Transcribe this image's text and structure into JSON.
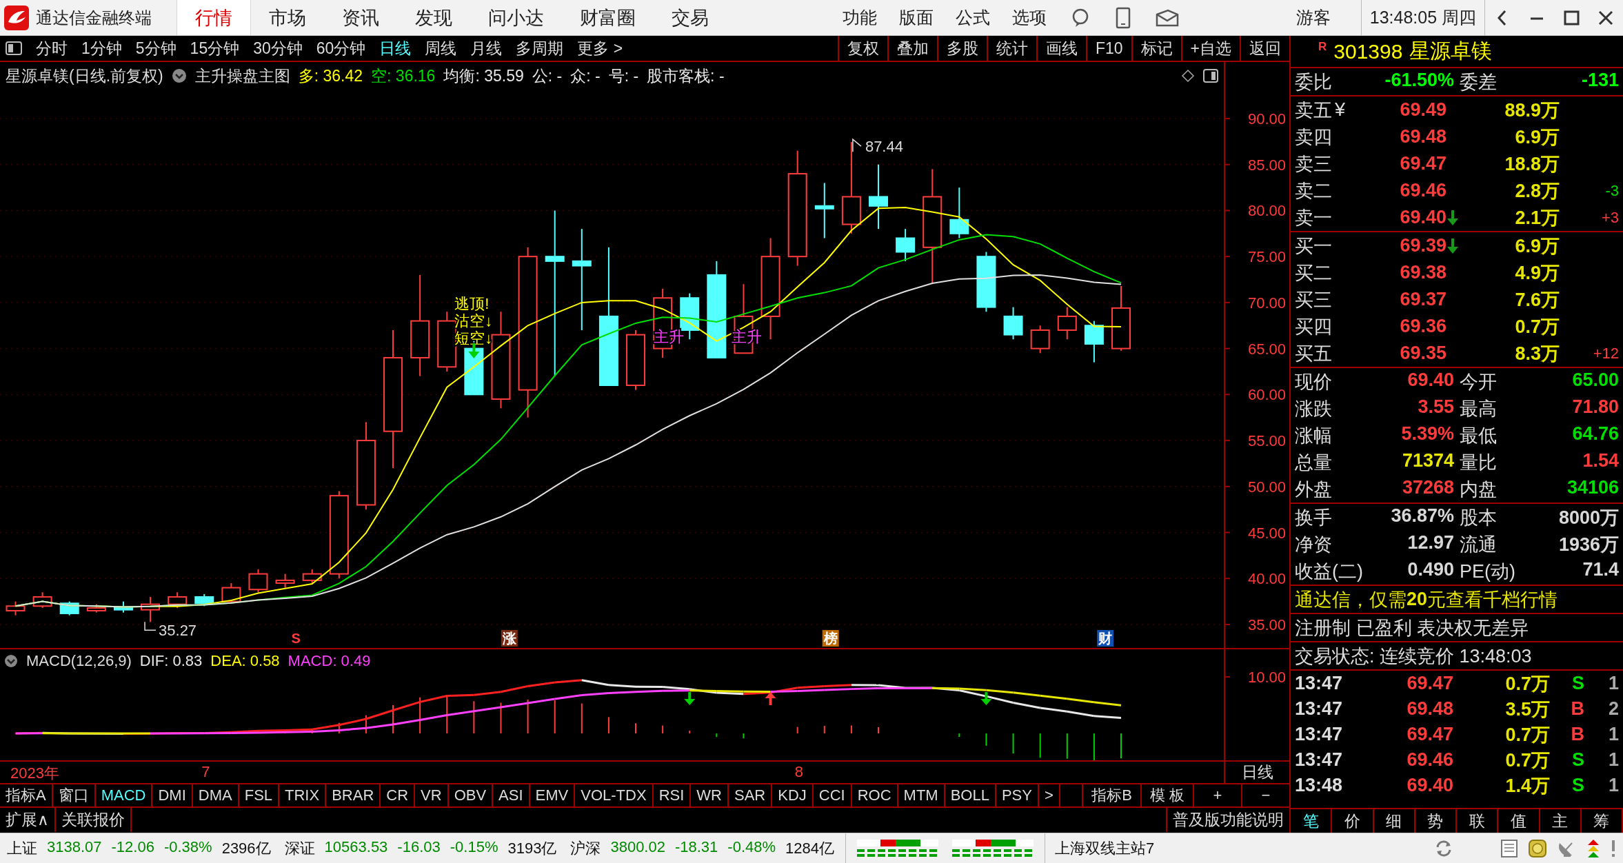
{
  "app": {
    "title": "通达信金融终端"
  },
  "menu": [
    {
      "label": "行情",
      "selected": true
    },
    {
      "label": "市场",
      "selected": false
    },
    {
      "label": "资讯",
      "selected": false
    },
    {
      "label": "发现",
      "selected": false
    },
    {
      "label": "问小达",
      "selected": false
    },
    {
      "label": "财富圈",
      "selected": false
    },
    {
      "label": "交易",
      "selected": false
    }
  ],
  "top_actions": [
    "功能",
    "版面",
    "公式",
    "选项"
  ],
  "user": "游客",
  "clock": "13:48:05 周四",
  "periods": [
    {
      "label": "分时",
      "selected": false
    },
    {
      "label": "1分钟",
      "selected": false
    },
    {
      "label": "5分钟",
      "selected": false
    },
    {
      "label": "15分钟",
      "selected": false
    },
    {
      "label": "30分钟",
      "selected": false
    },
    {
      "label": "60分钟",
      "selected": false
    },
    {
      "label": "日线",
      "selected": true
    },
    {
      "label": "周线",
      "selected": false
    },
    {
      "label": "月线",
      "selected": false
    },
    {
      "label": "多周期",
      "selected": false
    },
    {
      "label": "更多 >",
      "selected": false
    }
  ],
  "tools": [
    "复权",
    "叠加",
    "多股",
    "统计",
    "画线",
    "F10",
    "标记",
    "+自选",
    "返回"
  ],
  "chart": {
    "title": "星源卓镁(日线.前复权)",
    "indicator": "主升操盘主图",
    "legend": [
      {
        "text": "多: 36.42",
        "color": "#ffff00"
      },
      {
        "text": "空: 36.16",
        "color": "#00e000"
      },
      {
        "text": "均衡: 35.59",
        "color": "#e8e8e8"
      },
      {
        "text": "公: -",
        "color": "#e8e8e8"
      },
      {
        "text": "众: -",
        "color": "#e8e8e8"
      },
      {
        "text": "号: -",
        "color": "#e8e8e8"
      },
      {
        "text": "股市客栈: -",
        "color": "#e8e8e8"
      }
    ],
    "y_labels": [
      "90.00",
      "85.00",
      "80.00",
      "75.00",
      "70.00",
      "65.00",
      "60.00",
      "55.00",
      "50.00",
      "45.00",
      "40.00",
      "35.00"
    ],
    "high_label": "87.44",
    "low_label": "35.27",
    "signals": [
      "逃顶!",
      "沽空↓",
      "短空↓"
    ],
    "trend_tags": [
      "主升",
      "主升"
    ],
    "markers": [
      {
        "text": "S",
        "kind": "sell"
      },
      {
        "text": "涨",
        "kind": "limit"
      },
      {
        "text": "榜",
        "kind": "list"
      },
      {
        "text": "财",
        "kind": "report"
      }
    ]
  },
  "macd": {
    "title": "MACD(12,26,9)",
    "legend": [
      {
        "text": "DIF: 0.83",
        "color": "#e8e8e8"
      },
      {
        "text": "DEA: 0.58",
        "color": "#ffff00"
      },
      {
        "text": "MACD: 0.49",
        "color": "#ff40ff"
      }
    ],
    "y_label": "10.00"
  },
  "dates": [
    "2023年",
    "7",
    "8"
  ],
  "period_label": "日线",
  "indicator_tabs": [
    {
      "label": "指标A",
      "selected": false
    },
    {
      "label": "窗口",
      "selected": false
    },
    {
      "label": "MACD",
      "selected": true
    },
    {
      "label": "DMI",
      "selected": false
    },
    {
      "label": "DMA",
      "selected": false
    },
    {
      "label": "FSL",
      "selected": false
    },
    {
      "label": "TRIX",
      "selected": false
    },
    {
      "label": "BRAR",
      "selected": false
    },
    {
      "label": "CR",
      "selected": false
    },
    {
      "label": "VR",
      "selected": false
    },
    {
      "label": "OBV",
      "selected": false
    },
    {
      "label": "ASI",
      "selected": false
    },
    {
      "label": "EMV",
      "selected": false
    },
    {
      "label": "VOL-TDX",
      "selected": false
    },
    {
      "label": "RSI",
      "selected": false
    },
    {
      "label": "WR",
      "selected": false
    },
    {
      "label": "SAR",
      "selected": false
    },
    {
      "label": "KDJ",
      "selected": false
    },
    {
      "label": "CCI",
      "selected": false
    },
    {
      "label": "ROC",
      "selected": false
    },
    {
      "label": "MTM",
      "selected": false
    },
    {
      "label": "BOLL",
      "selected": false
    },
    {
      "label": "PSY",
      "selected": false
    },
    {
      "label": ">",
      "selected": false
    }
  ],
  "indicator_tools": [
    "指标B",
    "模 板",
    "+",
    "−"
  ],
  "ext_tabs": [
    "扩展∧",
    "关联报价"
  ],
  "help": "普及版功能说明",
  "quote": {
    "market": "R",
    "code": "301398",
    "name": "星源卓镁",
    "ratio": [
      {
        "label": "委比",
        "value": "-61.50%"
      },
      {
        "label": "委差",
        "value": "-131"
      }
    ],
    "asks": [
      {
        "label": "卖五",
        "badge": "¥",
        "price": "69.49",
        "arrow_down": false,
        "volume": "88.9万"
      },
      {
        "label": "卖四",
        "price": "69.48",
        "arrow_down": false,
        "volume": "6.9万"
      },
      {
        "label": "卖三",
        "price": "69.47",
        "arrow_down": false,
        "volume": "18.8万"
      },
      {
        "label": "卖二",
        "price": "69.46",
        "arrow_down": false,
        "volume": "2.8万",
        "change": {
          "text": "-3",
          "color": "#00e000"
        }
      },
      {
        "label": "卖一",
        "price": "69.40",
        "arrow_down": true,
        "volume": "2.1万",
        "change": {
          "text": "+3",
          "color": "#ff3c3c"
        }
      }
    ],
    "bids": [
      {
        "label": "买一",
        "price": "69.39",
        "arrow_down": true,
        "volume": "6.9万"
      },
      {
        "label": "买二",
        "price": "69.38",
        "arrow_down": false,
        "volume": "4.9万"
      },
      {
        "label": "买三",
        "price": "69.37",
        "arrow_down": false,
        "volume": "7.6万"
      },
      {
        "label": "买四",
        "price": "69.36",
        "arrow_down": false,
        "volume": "0.7万"
      },
      {
        "label": "买五",
        "price": "69.35",
        "arrow_down": false,
        "volume": "8.3万",
        "change": {
          "text": "+12",
          "color": "#ff3c3c"
        }
      }
    ],
    "stats": [
      [
        {
          "label": "现价",
          "value": "69.40",
          "color": "#ff3c3c"
        },
        {
          "label": "今开",
          "value": "65.00",
          "color": "#00e000"
        }
      ],
      [
        {
          "label": "涨跌",
          "value": "3.55",
          "color": "#ff3c3c"
        },
        {
          "label": "最高",
          "value": "71.80",
          "color": "#ff3c3c"
        }
      ],
      [
        {
          "label": "涨幅",
          "value": "5.39%",
          "color": "#ff3c3c"
        },
        {
          "label": "最低",
          "value": "64.76",
          "color": "#00e000"
        }
      ],
      [
        {
          "label": "总量",
          "value": "71374",
          "color": "#e6e600"
        },
        {
          "label": "量比",
          "value": "1.54",
          "color": "#ff3c3c"
        }
      ],
      [
        {
          "label": "外盘",
          "value": "37268",
          "color": "#ff3c3c"
        },
        {
          "label": "内盘",
          "value": "34106",
          "color": "#00e000"
        }
      ]
    ],
    "fundamentals": [
      [
        {
          "label": "换手",
          "value": "36.87%"
        },
        {
          "label": "股本",
          "value": "8000万"
        }
      ],
      [
        {
          "label": "净资",
          "value": "12.97"
        },
        {
          "label": "流通",
          "value": "1936万"
        }
      ],
      [
        {
          "label": "收益(二)",
          "value": "0.490"
        },
        {
          "label": "PE(动)",
          "value": "71.4"
        }
      ]
    ],
    "ad": "通达信，仅需**20**元查看千档行情",
    "notice": "注册制 已盈利 表决权无差异",
    "trade_status": "交易状态: 连续竞价 13:48:03",
    "ticks": [
      {
        "time": "13:47",
        "price": "69.47",
        "volume": "0.7万",
        "side": "S",
        "color": "#00e000",
        "count": "1"
      },
      {
        "time": "13:47",
        "price": "69.48",
        "volume": "3.5万",
        "side": "B",
        "color": "#ff3c3c",
        "count": "2"
      },
      {
        "time": "13:47",
        "price": "69.47",
        "volume": "0.7万",
        "side": "B",
        "color": "#ff3c3c",
        "count": "1"
      },
      {
        "time": "13:47",
        "price": "69.46",
        "volume": "0.7万",
        "side": "S",
        "color": "#00e000",
        "count": "1"
      },
      {
        "time": "13:48",
        "price": "69.40",
        "volume": "1.4万",
        "side": "S",
        "color": "#00e000",
        "count": "1"
      }
    ]
  },
  "detail_tabs": [
    {
      "label": "笔",
      "selected": true
    },
    {
      "label": "价",
      "selected": false
    },
    {
      "label": "细",
      "selected": false
    },
    {
      "label": "势",
      "selected": false
    },
    {
      "label": "联",
      "selected": false
    },
    {
      "label": "值",
      "selected": false
    },
    {
      "label": "主",
      "selected": false
    },
    {
      "label": "筹",
      "selected": false
    }
  ],
  "indices": [
    {
      "name": "上证",
      "value": "3138.07",
      "change": "-12.06",
      "pct": "-0.38%",
      "amount": "2396亿"
    },
    {
      "name": "深证",
      "value": "10563.53",
      "change": "-16.03",
      "pct": "-0.15%",
      "amount": "3193亿"
    },
    {
      "name": "沪深",
      "value": "3800.02",
      "change": "-18.31",
      "pct": "-0.48%",
      "amount": "1284亿"
    }
  ],
  "server": "上海双线主站7"
}
